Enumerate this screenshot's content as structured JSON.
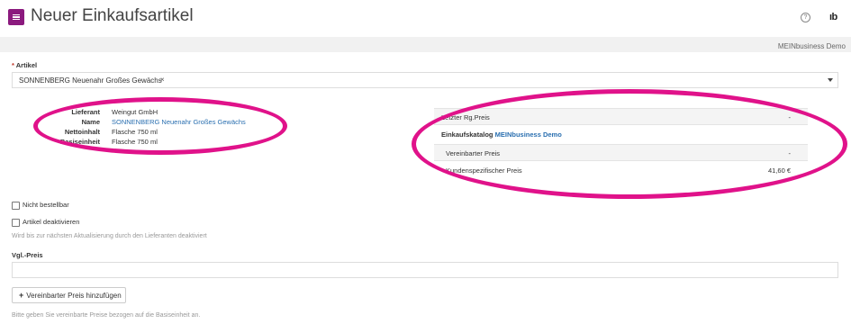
{
  "header": {
    "title": "Neuer Einkaufsartikel",
    "company": "MEINbusiness Demo",
    "logo_text": "ıb",
    "help_symbol": "?"
  },
  "icons": {
    "menu": "hamburger-icon",
    "help": "help-icon",
    "logo": "brand-logo-icon"
  },
  "accent_color": "#8b1a7e",
  "highlight_color": "#e0128a",
  "link_color": "#2a6fb0",
  "article": {
    "label": "Artikel",
    "required_marker": "*",
    "selected_value": "SONNENBERG Neuenahr Großes Gewächs",
    "clear_symbol": "×"
  },
  "details": [
    {
      "key": "Lieferant",
      "value": "Weingut GmbH",
      "link": false
    },
    {
      "key": "Name",
      "value": "SONNENBERG Neuenahr Großes Gewächs",
      "link": true
    },
    {
      "key": "Nettoinhalt",
      "value": "Flasche 750 ml",
      "link": false
    },
    {
      "key": "Basiseinheit",
      "value": "Flasche 750 ml",
      "link": false
    }
  ],
  "prices": {
    "last_price_label": "Letzter Rg.Preis",
    "last_price_value": "-",
    "catalog_label": "Einkaufskatalog",
    "catalog_name": "MEINbusiness Demo",
    "agreed_price_label": "Vereinbarter Preis",
    "agreed_price_value": "-",
    "customer_price_label": "Kundenspezifischer Preis",
    "customer_price_value": "41,60 €"
  },
  "options": {
    "not_orderable_label": "Nicht bestellbar",
    "deactivate_label": "Artikel deaktivieren",
    "deactivate_hint": "Wird bis zur nächsten Aktualisierung durch den Lieferanten deaktiviert"
  },
  "comparison_price": {
    "label": "Vgl.-Preis",
    "value": ""
  },
  "add_agreed_price_button": "Vereinbarter Preis hinzufügen",
  "footer_hint": "Bitte geben Sie vereinbarte Preise bezogen auf die Basiseinheit an."
}
